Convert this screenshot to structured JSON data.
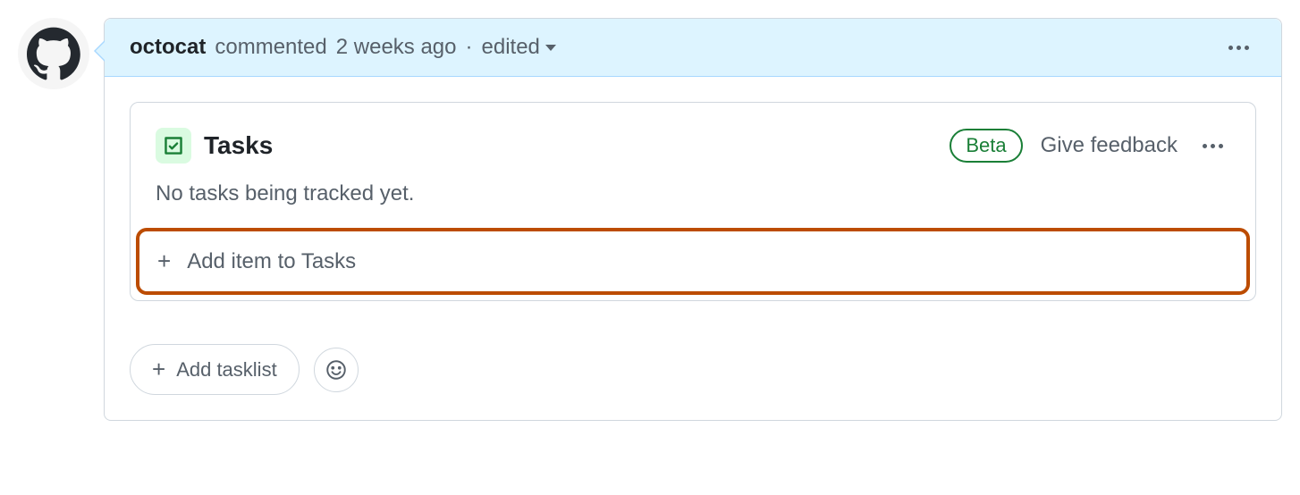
{
  "comment": {
    "author": "octocat",
    "action_text": "commented",
    "timestamp": "2 weeks ago",
    "separator": "·",
    "edited_label": "edited"
  },
  "tasks": {
    "title": "Tasks",
    "beta_label": "Beta",
    "feedback_label": "Give feedback",
    "empty_message": "No tasks being tracked yet.",
    "add_item_label": "Add item to Tasks"
  },
  "footer": {
    "add_tasklist_label": "Add tasklist"
  }
}
